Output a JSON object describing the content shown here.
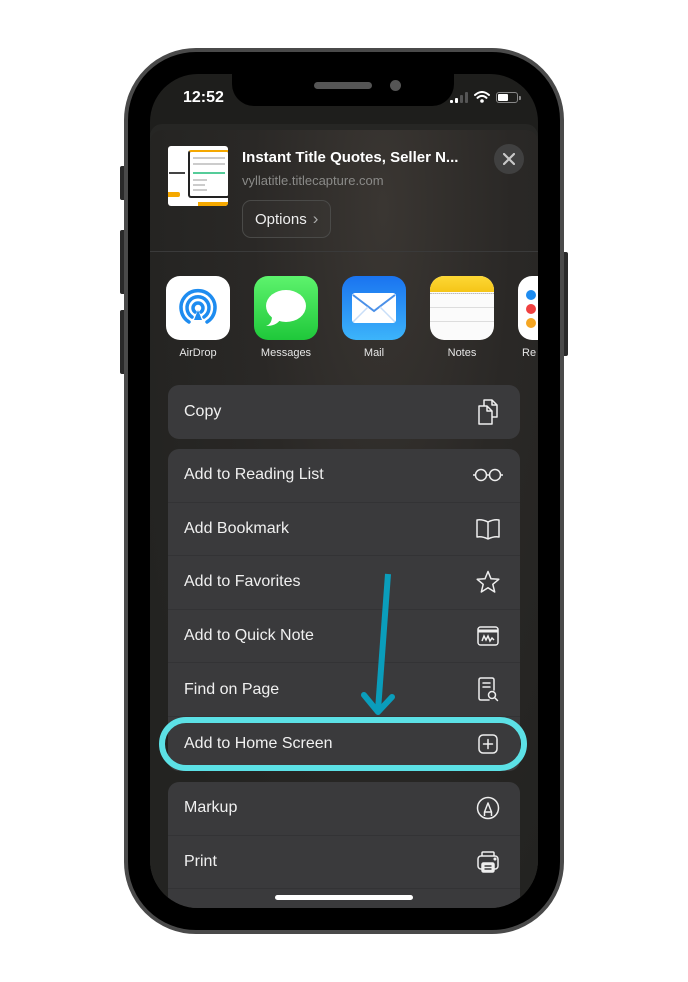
{
  "status_bar": {
    "time": "12:52"
  },
  "share_header": {
    "title": "Instant Title Quotes, Seller N...",
    "url": "vyllatitle.titlecapture.com",
    "options_label": "Options",
    "options_chevron": "›",
    "close_icon": "close-icon"
  },
  "apps": [
    {
      "label": "AirDrop",
      "icon": "airdrop-icon"
    },
    {
      "label": "Messages",
      "icon": "messages-icon"
    },
    {
      "label": "Mail",
      "icon": "mail-icon"
    },
    {
      "label": "Notes",
      "icon": "notes-icon"
    },
    {
      "label": "Re",
      "icon": "reminders-icon"
    }
  ],
  "actions": {
    "group1": [
      {
        "label": "Copy",
        "icon": "copy-icon"
      }
    ],
    "group2": [
      {
        "label": "Add to Reading List",
        "icon": "glasses-icon"
      },
      {
        "label": "Add Bookmark",
        "icon": "book-icon"
      },
      {
        "label": "Add to Favorites",
        "icon": "star-icon"
      },
      {
        "label": "Add to Quick Note",
        "icon": "quick-note-icon"
      },
      {
        "label": "Find on Page",
        "icon": "find-on-page-icon"
      },
      {
        "label": "Add to Home Screen",
        "icon": "add-square-icon"
      }
    ],
    "group3": [
      {
        "label": "Markup",
        "icon": "markup-icon"
      },
      {
        "label": "Print",
        "icon": "printer-icon"
      }
    ]
  },
  "annotation": {
    "highlighted_item": "Add to Home Screen",
    "ring_color": "#5ce1e6",
    "arrow_color": "#0a9dbb"
  }
}
